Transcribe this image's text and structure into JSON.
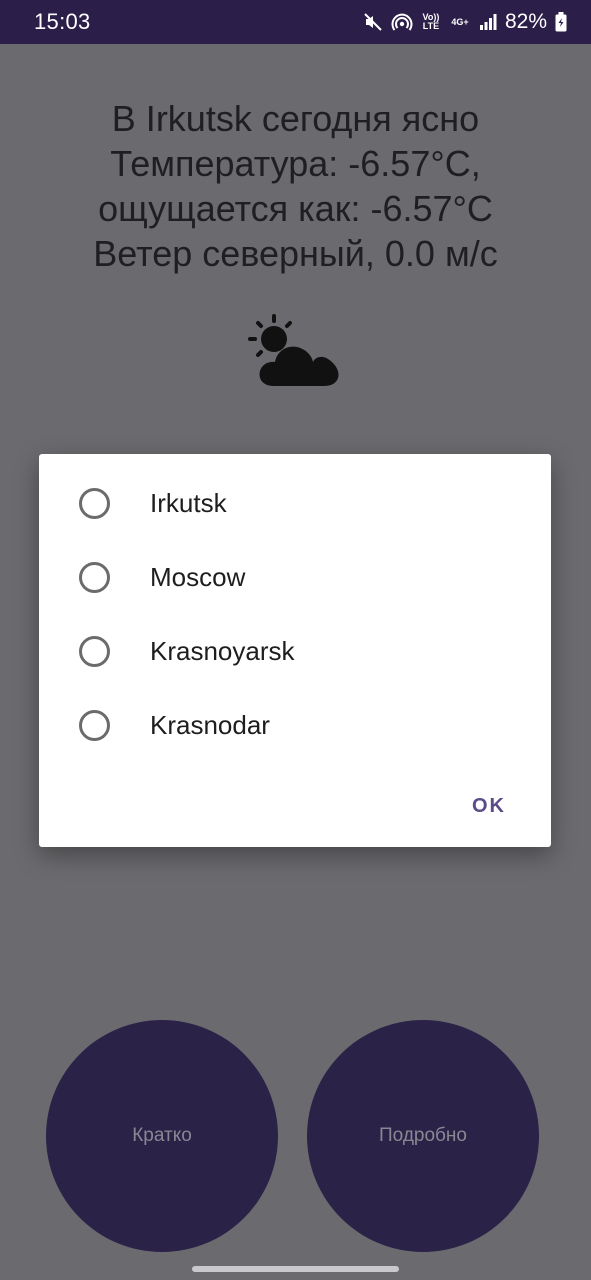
{
  "status_bar": {
    "time": "15:03",
    "volte_label": "Vo)) LTE",
    "network_label": "4G+",
    "battery": "82%",
    "icons": [
      "mute-icon",
      "hotspot-icon",
      "volte-icon",
      "network-4g-icon",
      "signal-icon",
      "battery-charging-icon"
    ]
  },
  "weather": {
    "line1": "В Irkutsk сегодня ясно",
    "line2": "Температура: -6.57°C,",
    "line3": "ощущается как: -6.57°C",
    "line4": "Ветер северный, 0.0 м/с",
    "icon": "partly-cloudy-icon"
  },
  "buttons": {
    "short": "Кратко",
    "detailed": "Подробно"
  },
  "dialog": {
    "options": [
      "Irkutsk",
      "Moscow",
      "Krasnoyarsk",
      "Krasnodar"
    ],
    "selected": null,
    "ok_label": "OK"
  },
  "colors": {
    "status_bar": "#2b1f4a",
    "scrim_background": "#6b6a6e",
    "button_fill": "#2b2248",
    "accent": "#5b4b8a"
  }
}
